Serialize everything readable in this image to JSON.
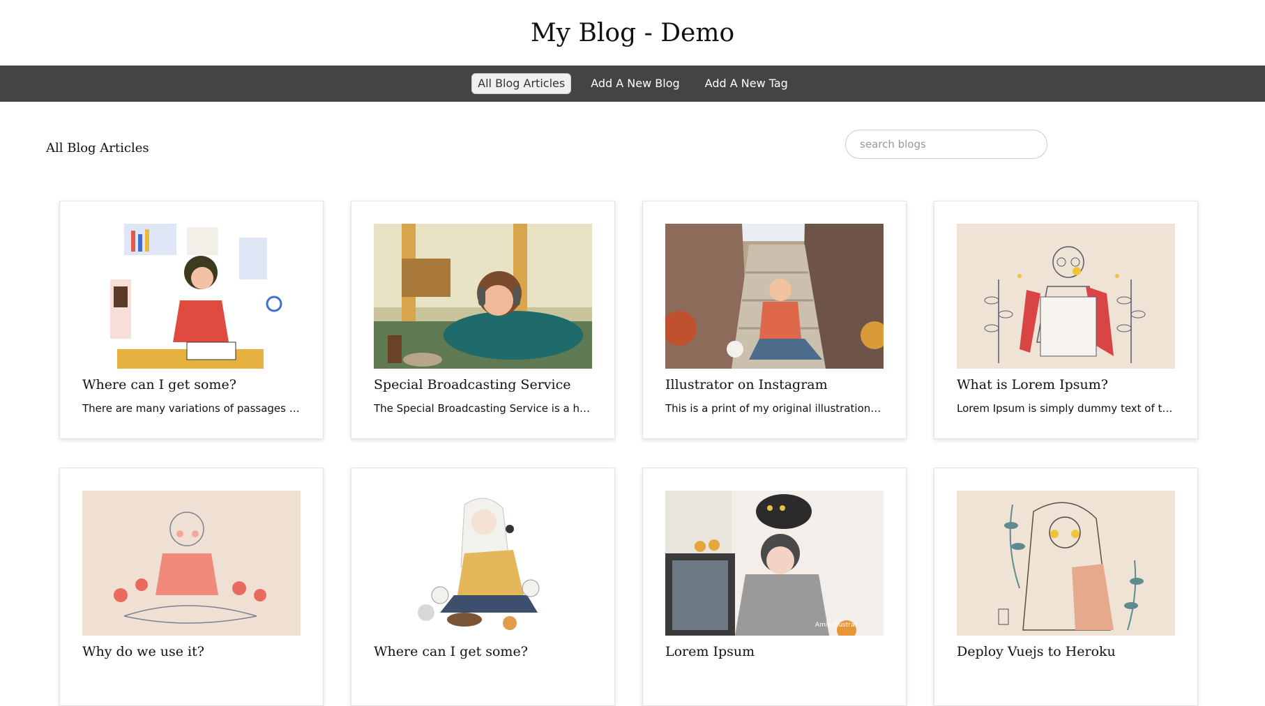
{
  "site": {
    "title": "My Blog - Demo"
  },
  "nav": {
    "items": [
      {
        "label": "All Blog Articles",
        "active": true
      },
      {
        "label": "Add A New Blog",
        "active": false
      },
      {
        "label": "Add A New Tag",
        "active": false
      }
    ]
  },
  "page": {
    "section_title": "All Blog Articles",
    "search_placeholder": "search blogs"
  },
  "articles": [
    {
      "title": "Where can I get some?",
      "excerpt": "There are many variations of passages of…"
    },
    {
      "title": "Special Broadcasting Service",
      "excerpt": "The Special Broadcasting Service is a hyb…"
    },
    {
      "title": "Illustrator on Instagram",
      "excerpt": "This is a print of my original illustration a…"
    },
    {
      "title": "What is Lorem Ipsum?",
      "excerpt": "Lorem Ipsum is simply dummy text of th…"
    },
    {
      "title": "Why do we use it?",
      "excerpt": ""
    },
    {
      "title": "Where can I get some?",
      "excerpt": ""
    },
    {
      "title": "Lorem Ipsum",
      "excerpt": ""
    },
    {
      "title": "Deploy Vuejs to Heroku",
      "excerpt": ""
    }
  ],
  "images": {
    "signature_text": "Amie·Illustrat"
  }
}
